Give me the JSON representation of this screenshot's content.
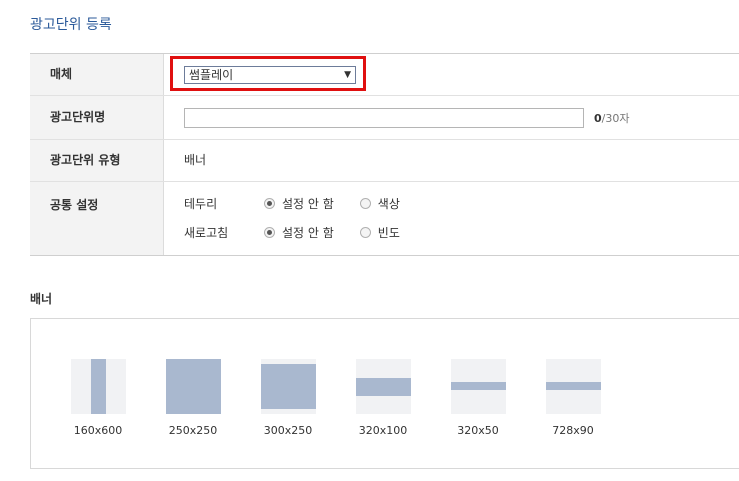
{
  "page_title": "광고단위 등록",
  "form": {
    "media_label": "매체",
    "media_value": "썸플레이",
    "name_label": "광고단위명",
    "name_value": "",
    "name_counter_current": "0",
    "name_counter_max": "/30자",
    "type_label": "광고단위 유형",
    "type_value": "배너",
    "common_label": "공통 설정",
    "border_label": "테두리",
    "border_opt1": "설정 안 함",
    "border_opt2": "색상",
    "refresh_label": "새로고침",
    "refresh_opt1": "설정 안 함",
    "refresh_opt2": "빈도"
  },
  "banner_section": {
    "title": "배너",
    "sizes": [
      "160x600",
      "250x250",
      "300x250",
      "320x100",
      "320x50",
      "728x90"
    ]
  }
}
